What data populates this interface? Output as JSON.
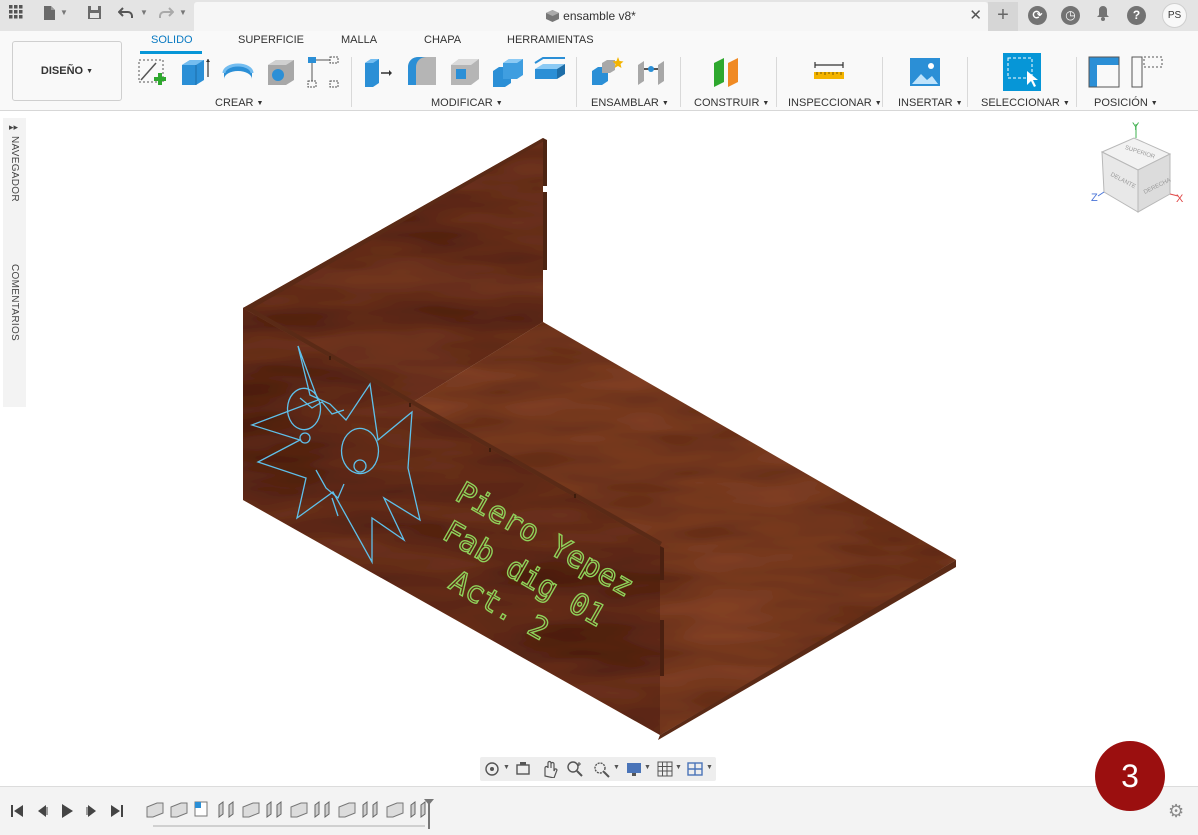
{
  "titlebar": {
    "document_title": "ensamble v8*",
    "avatar_initials": "PS"
  },
  "workspace": {
    "mode_button": "DISEÑO"
  },
  "ribbon": {
    "tabs": [
      {
        "label": "SOLIDO",
        "active": true
      },
      {
        "label": "SUPERFICIE",
        "active": false
      },
      {
        "label": "MALLA",
        "active": false
      },
      {
        "label": "CHAPA",
        "active": false
      },
      {
        "label": "HERRAMIENTAS",
        "active": false
      }
    ],
    "groups": {
      "crear": "CREAR",
      "modificar": "MODIFICAR",
      "ensamblar": "ENSAMBLAR",
      "construir": "CONSTRUIR",
      "inspeccionar": "INSPECCIONAR",
      "insertar": "INSERTAR",
      "seleccionar": "SELECCIONAR",
      "posicion": "POSICIÓN"
    }
  },
  "sidepanel": {
    "navegador": "NAVEGADOR",
    "comentarios": "COMENTARIOS"
  },
  "viewcube": {
    "top": "SUPERIOR",
    "front": "DELANTE",
    "right": "DERECHA",
    "axis_x": "X",
    "axis_y": "Y",
    "axis_z": "Z"
  },
  "model": {
    "engraving_lines": [
      "Piero Yepez",
      "Fab dig 01",
      "Act. 2"
    ],
    "wood_color": "#7a3a22",
    "engraving_color": "#8fd15a",
    "mask_color": "#5fc0ea"
  },
  "badge": {
    "value": "3",
    "color": "#9b0f0f"
  },
  "colors": {
    "accent": "#0696d7",
    "select_active": "#0696d7"
  }
}
